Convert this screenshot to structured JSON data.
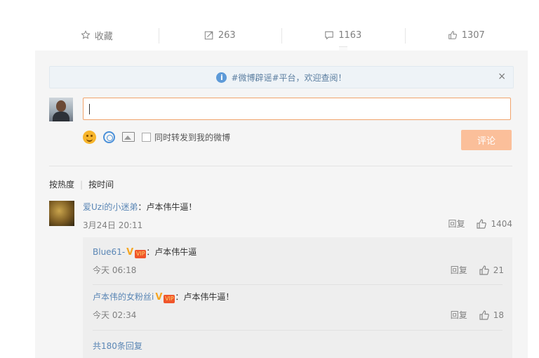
{
  "actions": {
    "favorite": "收藏",
    "repost_count": "263",
    "comment_count": "1163",
    "like_count": "1307"
  },
  "notice": {
    "text": "#微博辟谣#平台，欢迎查阅！",
    "close": "×"
  },
  "composer": {
    "checkbox_label": "同时转发到我的微博",
    "submit_label": "评论"
  },
  "sort": {
    "hot": "按热度",
    "separator": "|",
    "time": "按时间"
  },
  "comment": {
    "user": "爱Uzi的小迷弟",
    "text": "：卢本伟牛逼！",
    "time": "3月24日 20:11",
    "reply_label": "回复",
    "likes": "1404"
  },
  "replies": [
    {
      "user": "Blue61-",
      "text": "：卢本伟牛逼",
      "time": "今天 06:18",
      "reply_label": "回复",
      "likes": "21"
    },
    {
      "user": "卢本伟的女粉丝i",
      "text": "：卢本伟牛逼！",
      "time": "今天 02:34",
      "reply_label": "回复",
      "likes": "18"
    }
  ],
  "more_replies": "共180条回复",
  "badges": {
    "v": "V",
    "vip": "VIP"
  },
  "colors": {
    "accent": "#f0a36b",
    "link": "#5a86b5",
    "submit_bg": "#fbbf9a",
    "badge_v": "#f5a623"
  }
}
